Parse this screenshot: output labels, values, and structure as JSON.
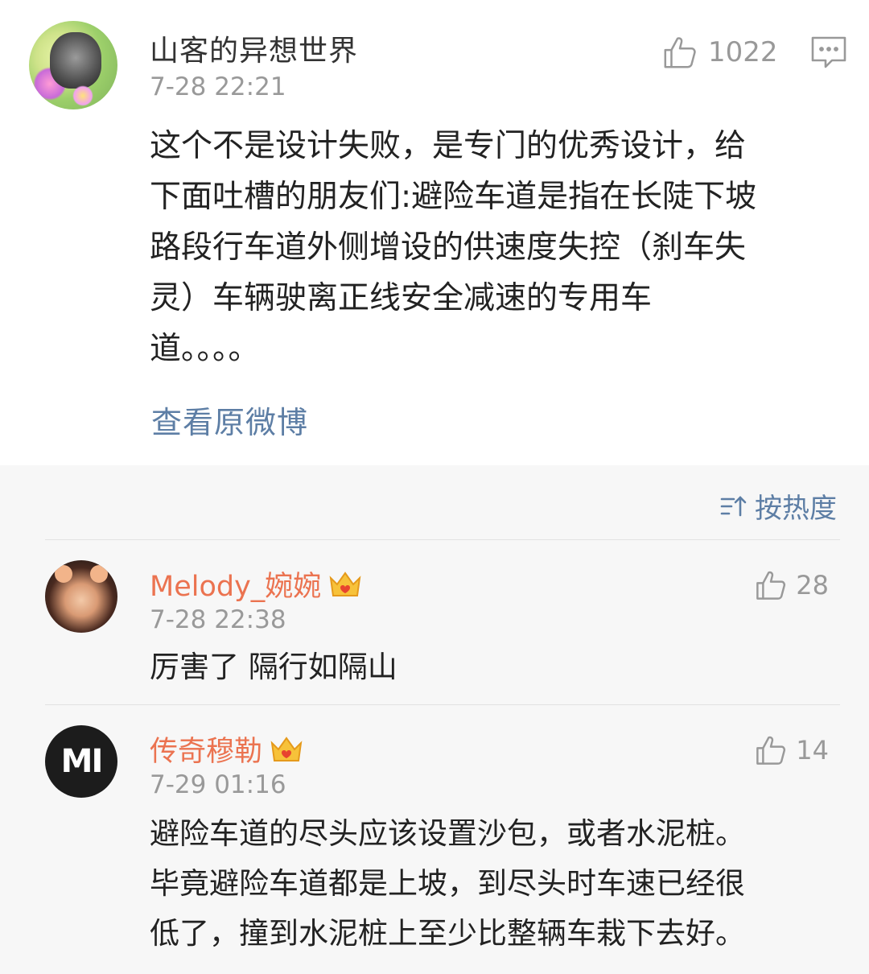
{
  "main_comment": {
    "username": "山客的异想世界",
    "timestamp": "7-28 22:21",
    "like_count": "1022",
    "text_lines": [
      "这个不是设计失败，是专门的优秀设计，给",
      "下面吐槽的朋友们:避险车道是指在长陡下坡",
      "路段行车道外侧增设的供速度失控（刹车失",
      "灵）车辆驶离正线安全减速的专用车",
      "道。。。。"
    ],
    "view_original_label": "查看原微博",
    "icons": {
      "like": "thumbs-up-icon",
      "reply": "comment-bubble-icon"
    }
  },
  "sort": {
    "label": "按热度",
    "icon": "sort-icon"
  },
  "comments": [
    {
      "username": "Melody_婉婉",
      "badge": "crown-icon",
      "timestamp": "7-28 22:38",
      "like_count": "28",
      "text_lines": [
        "厉害了 隔行如隔山"
      ]
    },
    {
      "username": "传奇穆勒",
      "badge": "crown-icon",
      "timestamp": "7-29 01:16",
      "like_count": "14",
      "avatar_text": "MI",
      "text_lines": [
        "避险车道的尽头应该设置沙包，或者水泥桩。",
        "毕竟避险车道都是上坡，到尽头时车速已经很",
        "低了，撞到水泥桩上至少比整辆车栽下去好。"
      ]
    }
  ],
  "colors": {
    "username_accent": "#eb7350",
    "link_blue": "#5d7ea5",
    "meta_gray": "#999999",
    "comments_bg": "#f7f7f7"
  }
}
